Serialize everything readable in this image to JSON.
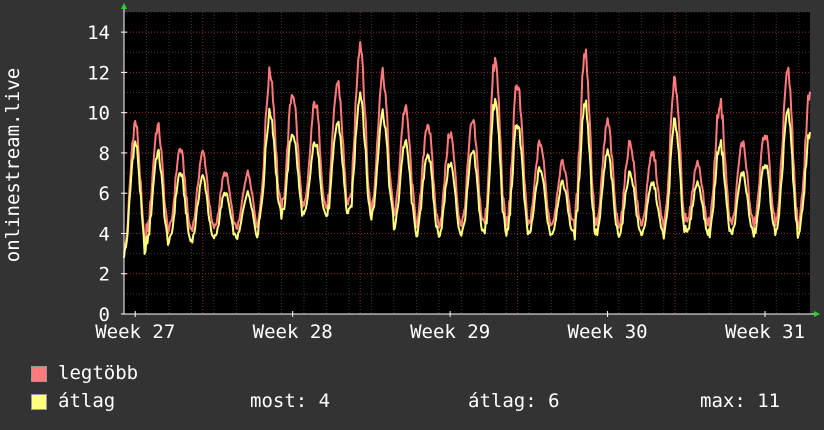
{
  "chart_data": {
    "type": "line",
    "title": "",
    "ylabel": "onlinestream.live",
    "xlabel": "",
    "ylim": [
      0,
      15
    ],
    "yticks": [
      0,
      2,
      4,
      6,
      8,
      10,
      12,
      14
    ],
    "yticks_labels": [
      "0",
      "2",
      "4",
      "6",
      "8",
      "10",
      "12",
      "14"
    ],
    "xticks_labels": [
      "Week 27",
      "Week 28",
      "Week 29",
      "Week 30",
      "Week 31"
    ],
    "x_unit": "days",
    "x_range": [
      0,
      30.5
    ],
    "xtick_positions": [
      0.5,
      7.5,
      14.5,
      21.5,
      28.5
    ],
    "grid": true,
    "legend_placement": "bottom-left",
    "series": [
      {
        "name": "legtöbb",
        "color": "#ff7a7a",
        "daily_peak": [
          9.5,
          9.3,
          8.2,
          8.0,
          7.0,
          7.0,
          12.0,
          11.0,
          10.5,
          11.5,
          13.5,
          12.0,
          10.2,
          9.5,
          9.0,
          9.5,
          12.5,
          11.5,
          8.5,
          7.5,
          13.0,
          9.5,
          8.5,
          8.0,
          11.5,
          7.5,
          10.5,
          8.5,
          9.0,
          12.0,
          11.0
        ],
        "daily_min": [
          3.2,
          4.2,
          4.2,
          4.3,
          4.3,
          4.3,
          5.3,
          5.3,
          5.3,
          5.3,
          5.3,
          5.3,
          5.0,
          4.5,
          4.5,
          4.5,
          4.5,
          4.5,
          4.5,
          4.5,
          4.5,
          4.5,
          4.5,
          4.5,
          4.5,
          4.5,
          4.5,
          4.5,
          4.5,
          4.5,
          4.6
        ]
      },
      {
        "name": "átlag",
        "color": "#ffff80",
        "daily_peak": [
          8.5,
          8.0,
          7.0,
          6.8,
          6.0,
          6.0,
          10.0,
          9.0,
          8.5,
          9.5,
          11.0,
          10.0,
          8.5,
          8.0,
          7.5,
          8.0,
          10.5,
          9.5,
          7.2,
          6.5,
          10.5,
          8.0,
          7.0,
          6.5,
          9.5,
          6.5,
          8.5,
          7.0,
          7.5,
          10.0,
          9.0
        ],
        "daily_min": [
          3.0,
          3.6,
          3.6,
          3.7,
          3.8,
          3.8,
          4.9,
          4.9,
          4.9,
          4.9,
          4.9,
          4.9,
          4.3,
          4.0,
          4.0,
          4.0,
          4.0,
          4.0,
          4.0,
          4.0,
          4.0,
          4.0,
          4.0,
          4.0,
          4.0,
          4.0,
          4.0,
          4.0,
          4.0,
          4.0,
          4.1
        ]
      }
    ]
  },
  "legend": {
    "items": [
      {
        "label": "legtöbb",
        "color": "#ff7a7a"
      },
      {
        "label": "átlag",
        "color": "#ffff80"
      }
    ],
    "stats": {
      "now": "most: 4",
      "avg": "átlag: 6",
      "max": "max: 11"
    }
  }
}
